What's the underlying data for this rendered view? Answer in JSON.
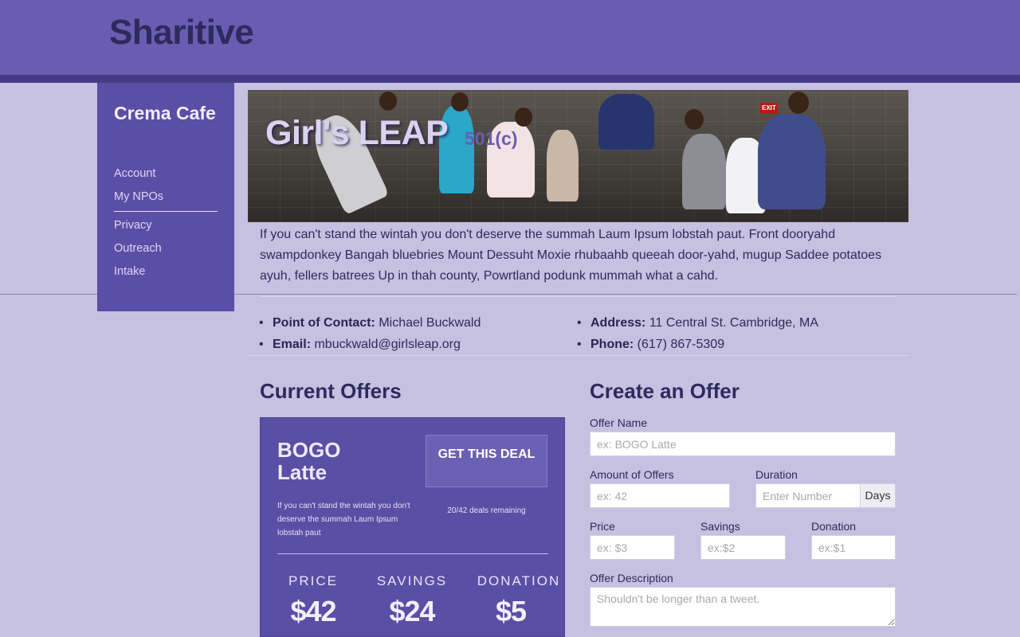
{
  "app": {
    "title": "Sharitive"
  },
  "sidebar": {
    "title": "Crema Cafe",
    "items": [
      {
        "label": "Account"
      },
      {
        "label": "My NPOs"
      },
      {
        "label": "Privacy"
      },
      {
        "label": "Outreach"
      },
      {
        "label": "Intake"
      }
    ]
  },
  "npo": {
    "name": "Girl's LEAP",
    "status": "501(c)",
    "exit_sign": "EXIT",
    "description": "If you can't stand the wintah you don't deserve the summah Laum Ipsum lobstah paut. Front dooryahd swampdonkey Bangah bluebries Mount Dessuht Moxie rhubaahb queeah door-yahd, mugup Saddee potatoes ayuh, fellers batrees Up in thah county, Powrtland podunk mummah what a cahd.",
    "contact": {
      "point_label": "Point of Contact:",
      "point_value": "Michael Buckwald",
      "email_label": "Email:",
      "email_value": "mbuckwald@girlsleap.org",
      "address_label": "Address:",
      "address_value": "11 Central St. Cambridge, MA",
      "phone_label": "Phone:",
      "phone_value": "(617) 867-5309"
    }
  },
  "current_offers": {
    "heading": "Current Offers",
    "offer": {
      "title": "BOGO Latte",
      "button": "GET THIS DEAL",
      "text": "If you can't stand the wintah you don't deserve the summah Laum Ipsum lobstah paut",
      "remaining": "20/42 deals remaining",
      "price_label": "PRICE",
      "price_value": "$42",
      "savings_label": "SAVINGS",
      "savings_value": "$24",
      "donation_label": "DONATION",
      "donation_value": "$5"
    }
  },
  "create_offer": {
    "heading": "Create an Offer",
    "offer_name_label": "Offer Name",
    "offer_name_placeholder": "ex: BOGO Latte",
    "amount_label": "Amount of Offers",
    "amount_placeholder": "ex: 42",
    "duration_label": "Duration",
    "duration_placeholder": "Enter Number",
    "duration_unit": "Days",
    "price_label": "Price",
    "price_placeholder": "ex: $3",
    "savings_label": "Savings",
    "savings_placeholder": "ex:$2",
    "donation_label": "Donation",
    "donation_placeholder": "ex:$1",
    "description_label": "Offer Description",
    "description_placeholder": "Shouldn't be longer than a tweet."
  },
  "theme": {
    "header_color": "#6a5cb0",
    "sidebar_color": "#5b4ea6",
    "background_color": "#c6c0e1",
    "card_color": "#5a4ea5"
  }
}
